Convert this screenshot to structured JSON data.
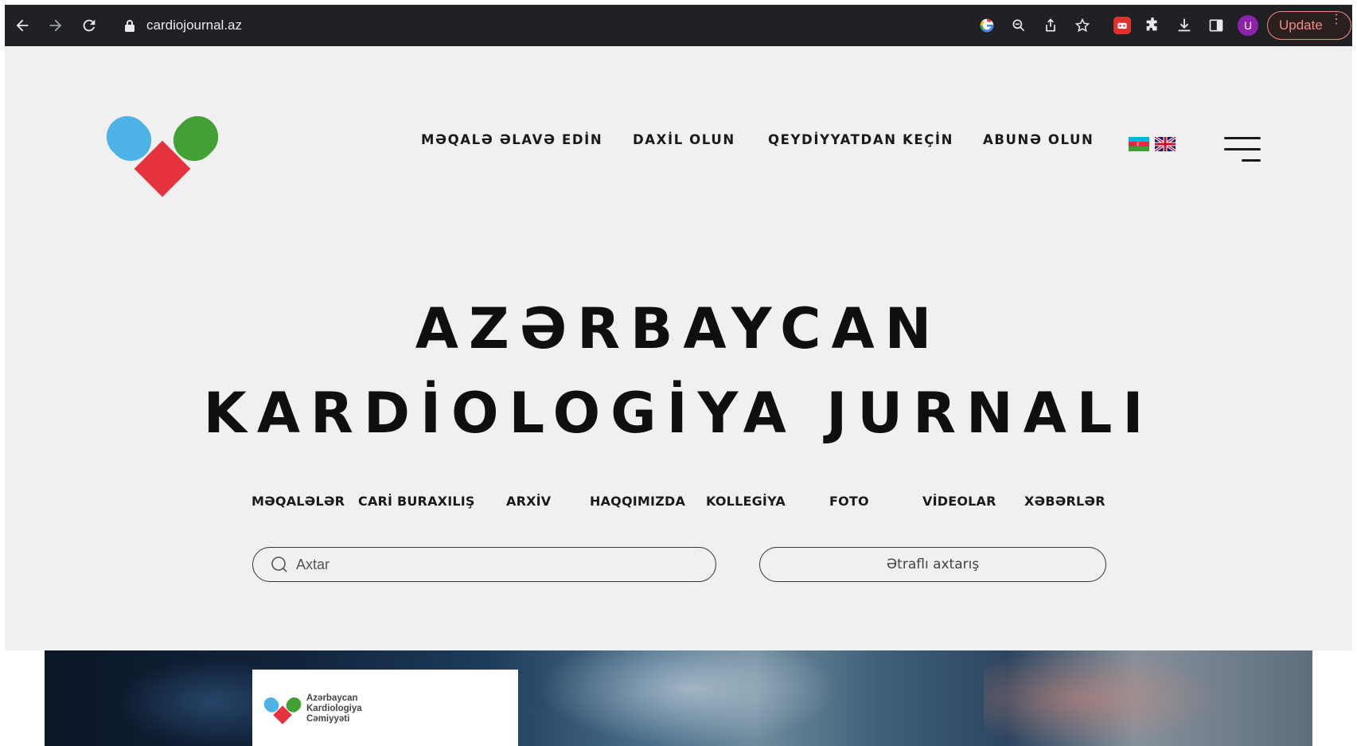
{
  "browser": {
    "url": "cardiojournal.az",
    "update_label": "Update",
    "avatar_letter": "U"
  },
  "header": {
    "nav": [
      {
        "label": "MƏQALƏ ƏLAVƏ EDİN"
      },
      {
        "label": "DAXİL OLUN"
      },
      {
        "label": "QEYDİYYATDAN KEÇİN"
      },
      {
        "label": "ABUNƏ OLUN"
      }
    ],
    "languages": [
      "az-flag-icon",
      "uk-flag-icon"
    ]
  },
  "hero": {
    "title_line1": "AZƏRBAYCAN",
    "title_line2": "KARDİOLOGİYA JURNALI"
  },
  "main_nav": [
    {
      "label": "MƏQALƏLƏR"
    },
    {
      "label": "CARİ BURAXILIŞ"
    },
    {
      "label": "ARXİV"
    },
    {
      "label": "HAQQIMIZDA"
    },
    {
      "label": "KOLLEGİYA"
    },
    {
      "label": "FOTO"
    },
    {
      "label": "VİDEOLAR"
    },
    {
      "label": "XƏBƏRLƏR"
    }
  ],
  "search": {
    "placeholder": "Axtar",
    "advanced_label": "Ətraflı axtarış"
  },
  "banner": {
    "org_line1": "Azərbaycan",
    "org_line2": "Kardiologiya",
    "org_line3": "Cəmiyyəti"
  },
  "colors": {
    "logo_blue": "#4db3e6",
    "logo_green": "#43a035",
    "logo_red": "#e5323e",
    "update_accent": "#f28b82"
  }
}
